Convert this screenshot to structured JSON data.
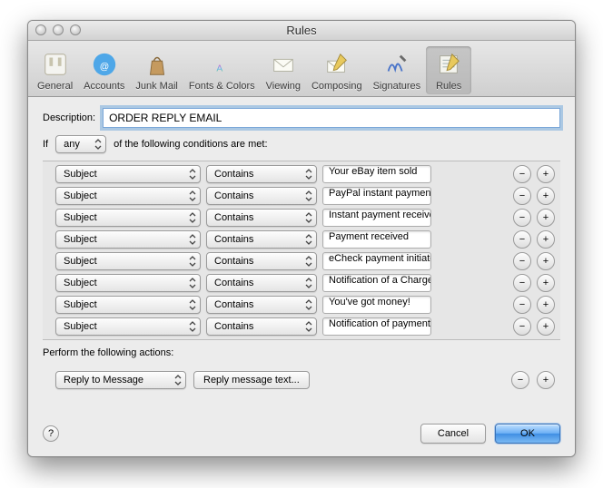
{
  "window": {
    "title": "Rules"
  },
  "toolbar": {
    "items": [
      {
        "label": "General"
      },
      {
        "label": "Accounts"
      },
      {
        "label": "Junk Mail"
      },
      {
        "label": "Fonts & Colors"
      },
      {
        "label": "Viewing"
      },
      {
        "label": "Composing"
      },
      {
        "label": "Signatures"
      },
      {
        "label": "Rules"
      }
    ],
    "selected_index": 7
  },
  "form": {
    "description_label": "Description:",
    "description_value": "ORDER REPLY EMAIL",
    "if_prefix": "If",
    "any_label": "any",
    "if_suffix": "of the following conditions are met:",
    "perform_label": "Perform the following actions:"
  },
  "conditions": [
    {
      "field": "Subject",
      "op": "Contains",
      "value": "Your eBay item sold"
    },
    {
      "field": "Subject",
      "op": "Contains",
      "value": "PayPal instant payment"
    },
    {
      "field": "Subject",
      "op": "Contains",
      "value": "Instant payment received"
    },
    {
      "field": "Subject",
      "op": "Contains",
      "value": "Payment received"
    },
    {
      "field": "Subject",
      "op": "Contains",
      "value": "eCheck payment initiated"
    },
    {
      "field": "Subject",
      "op": "Contains",
      "value": "Notification of a Chargeback"
    },
    {
      "field": "Subject",
      "op": "Contains",
      "value": "You've got money!"
    },
    {
      "field": "Subject",
      "op": "Contains",
      "value": "Notification of payment"
    }
  ],
  "actions": [
    {
      "action": "Reply to Message",
      "button": "Reply message text..."
    }
  ],
  "buttons": {
    "cancel": "Cancel",
    "ok": "OK",
    "remove": "−",
    "add": "+",
    "help": "?"
  }
}
